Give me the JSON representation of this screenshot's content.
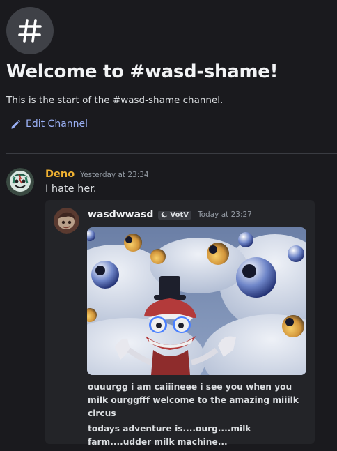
{
  "channel": {
    "icon": "hashtag-icon",
    "welcome_title": "Welcome to #wasd-shame!",
    "welcome_subtitle": "This is the start of the #wasd-shame channel.",
    "edit_label": "Edit Channel"
  },
  "message": {
    "username": "Deno",
    "timestamp": "Yesterday at 23:34",
    "text": "I hate her.",
    "username_color": "#f0b232"
  },
  "forwarded": {
    "username": "wasdwwasd",
    "clan_tag": "VotV",
    "timestamp": "Today at 23:27",
    "paragraphs": [
      "ouuurgg i am caiiineee i see you when you milk ourggfff welcome to the amazing miiilk circus",
      "todays adventure is....ourg....milk farm....udder milk machine..."
    ]
  },
  "colors": {
    "background": "#1a1a1e",
    "link": "#9ab0f5",
    "embed_bg": "#232428"
  }
}
